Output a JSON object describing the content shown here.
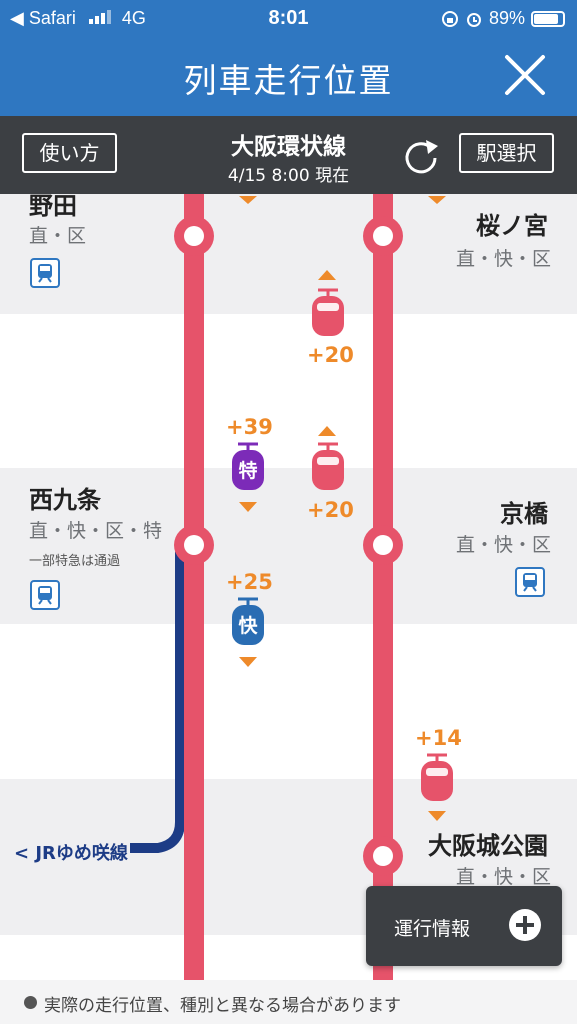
{
  "status_bar": {
    "back_app": "◀ Safari",
    "network": "4G",
    "time": "8:01",
    "battery": "89%"
  },
  "header": {
    "title": "列車走行位置"
  },
  "subheader": {
    "howto_label": "使い方",
    "line_name": "大阪環状線",
    "as_of": "4/15 8:00 現在",
    "station_select_label": "駅選択"
  },
  "colors": {
    "brand_blue": "#2f77c1",
    "dark_bar": "#3c3f43",
    "line_red": "#e6536a",
    "delay_orange": "#ee8a2a",
    "limited_express_purple": "#7c2bb8",
    "rapid_blue": "#2a6db3",
    "branch_navy": "#1d3c86"
  },
  "stations": {
    "nodamari": {
      "name": "野田",
      "types": "直・区",
      "icon": "train-icon"
    },
    "sakuranomiya": {
      "name": "桜ノ宮",
      "types": "直・快・区"
    },
    "nishikujo": {
      "name": "西九条",
      "types": "直・快・区・特",
      "note": "一部特急は通過",
      "icon": "train-icon"
    },
    "kyobashi": {
      "name": "京橋",
      "types": "直・快・区",
      "icon": "train-icon"
    },
    "osakajokoen": {
      "name": "大阪城公園",
      "types": "直・快・区"
    }
  },
  "branch": {
    "label": "JRゆめ咲線"
  },
  "trains": [
    {
      "id": "t1",
      "delay": "+20",
      "direction": "up",
      "type": "普通"
    },
    {
      "id": "t2",
      "delay": "+39",
      "direction": "down",
      "type_label": "特"
    },
    {
      "id": "t3",
      "delay": "+20",
      "direction": "up",
      "type": "普通"
    },
    {
      "id": "t4",
      "delay": "+25",
      "direction": "down",
      "type_label": "快"
    },
    {
      "id": "t5",
      "delay": "+14",
      "direction": "down",
      "type": "普通"
    }
  ],
  "operation_info": {
    "label": "運行情報"
  },
  "footer": {
    "note": "実際の走行位置、種別と異なる場合があります"
  }
}
